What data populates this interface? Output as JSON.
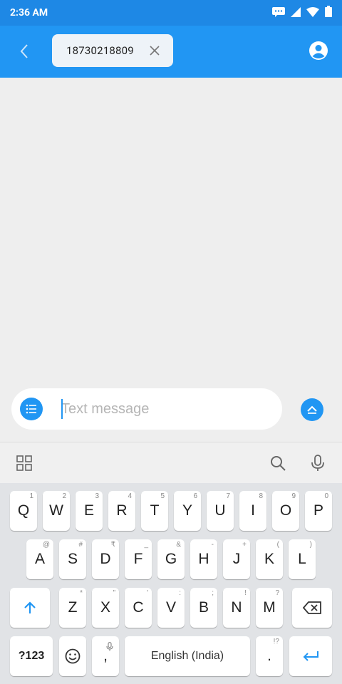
{
  "status_bar": {
    "time": "2:36 AM"
  },
  "header": {
    "recipient": "18730218809"
  },
  "compose": {
    "placeholder": "Text message"
  },
  "keyboard": {
    "row1": [
      {
        "label": "Q",
        "hint": "1"
      },
      {
        "label": "W",
        "hint": "2"
      },
      {
        "label": "E",
        "hint": "3"
      },
      {
        "label": "R",
        "hint": "4"
      },
      {
        "label": "T",
        "hint": "5"
      },
      {
        "label": "Y",
        "hint": "6"
      },
      {
        "label": "U",
        "hint": "7"
      },
      {
        "label": "I",
        "hint": "8"
      },
      {
        "label": "O",
        "hint": "9"
      },
      {
        "label": "P",
        "hint": "0"
      }
    ],
    "row2": [
      {
        "label": "A",
        "hint": "@"
      },
      {
        "label": "S",
        "hint": "#"
      },
      {
        "label": "D",
        "hint": "₹"
      },
      {
        "label": "F",
        "hint": "_"
      },
      {
        "label": "G",
        "hint": "&"
      },
      {
        "label": "H",
        "hint": "-"
      },
      {
        "label": "J",
        "hint": "+"
      },
      {
        "label": "K",
        "hint": "("
      },
      {
        "label": "L",
        "hint": ")"
      }
    ],
    "row3": [
      {
        "label": "Z",
        "hint": "*"
      },
      {
        "label": "X",
        "hint": "\""
      },
      {
        "label": "C",
        "hint": "'"
      },
      {
        "label": "V",
        "hint": ":"
      },
      {
        "label": "B",
        "hint": ";"
      },
      {
        "label": "N",
        "hint": "!"
      },
      {
        "label": "M",
        "hint": "?"
      }
    ],
    "symbols_label": "?123",
    "comma_label": ",",
    "space_label": "English (India)",
    "period_label": ".",
    "period_hint": "!?"
  },
  "colors": {
    "accent": "#2196f3",
    "status_bar": "#1e88e5",
    "background": "#eeeeee",
    "keyboard": "#e1e3e6"
  },
  "icons": {
    "status": [
      "message-notification-icon",
      "cellular-signal-icon",
      "wifi-icon",
      "battery-icon"
    ],
    "toolbar": [
      "grid-apps-icon",
      "search-icon",
      "microphone-icon"
    ]
  }
}
